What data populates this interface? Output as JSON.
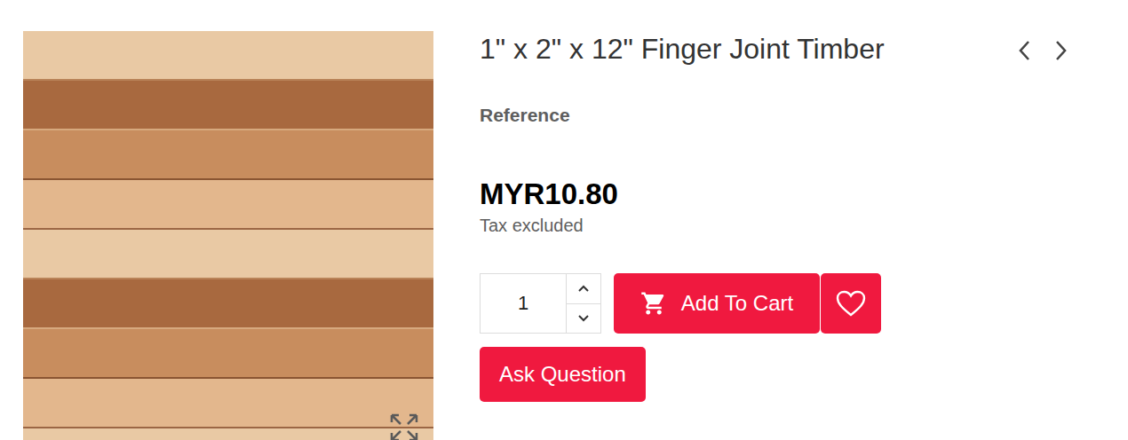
{
  "product": {
    "title": "1\" x 2\" x 12\" Finger Joint Timber",
    "reference_label": "Reference",
    "price": "MYR10.80",
    "tax_note": "Tax excluded"
  },
  "quantity": {
    "value": "1"
  },
  "buttons": {
    "add_to_cart": "Add To Cart",
    "ask_question": "Ask Question"
  }
}
